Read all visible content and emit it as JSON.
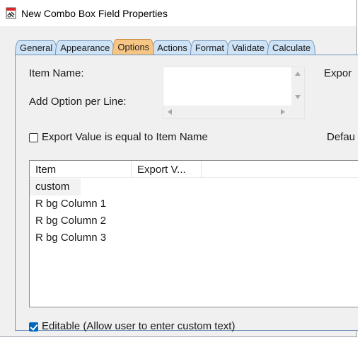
{
  "window": {
    "title": "New Combo Box Field Properties"
  },
  "tabs": [
    {
      "label": "General",
      "active": false
    },
    {
      "label": "Appearance",
      "active": false
    },
    {
      "label": "Options",
      "active": true
    },
    {
      "label": "Actions",
      "active": false
    },
    {
      "label": "Format",
      "active": false
    },
    {
      "label": "Validate",
      "active": false
    },
    {
      "label": "Calculate",
      "active": false
    }
  ],
  "options": {
    "item_name_label": "Item Name:",
    "add_option_label": "Add Option per Line:",
    "export_label": "Expor",
    "export_equal_label": "Export Value is equal to Item Name",
    "export_equal_checked": false,
    "default_label": "Defau",
    "list": {
      "columns": [
        "Item",
        "Export V..."
      ],
      "rows": [
        "custom",
        "R bg Column 1",
        "R bg Column 2",
        "R bg Column 3"
      ],
      "selected_index": 0
    },
    "editable_label": "Editable (Allow user to enter custom text)",
    "editable_checked": true
  },
  "colors": {
    "active_tab": "#f7c685",
    "inactive_tab": "#cfe3f6",
    "checkbox_accent": "#0067c0"
  }
}
